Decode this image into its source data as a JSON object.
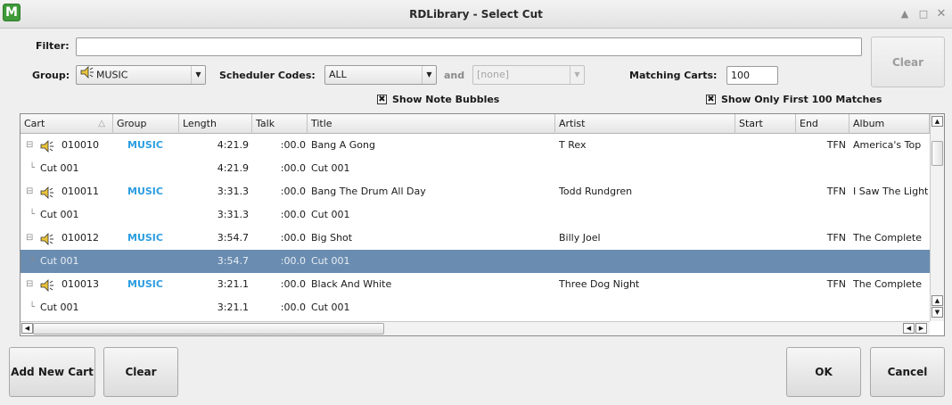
{
  "window": {
    "title": "RDLibrary - Select Cut",
    "app_icon_letter": "M",
    "controls": [
      "chevron-up",
      "maximize",
      "close"
    ]
  },
  "filter": {
    "label": "Filter:",
    "value": ""
  },
  "group": {
    "label": "Group:",
    "value": "MUSIC"
  },
  "scheduler": {
    "label": "Scheduler Codes:",
    "value": "ALL",
    "and_label": "and",
    "second_value": "[none]"
  },
  "matching": {
    "label": "Matching Carts:",
    "value": "100"
  },
  "top_clear_label": "Clear",
  "checks": {
    "note_bubbles": {
      "label": "Show Note Bubbles",
      "checked": true
    },
    "first_100": {
      "label": "Show Only First 100 Matches",
      "checked": true
    }
  },
  "columns": [
    "Cart",
    "Group",
    "Length",
    "Talk",
    "Title",
    "Artist",
    "Start",
    "End",
    "Album"
  ],
  "rows": [
    {
      "kind": "cart",
      "cart": "010010",
      "group": "MUSIC",
      "length": "4:21.9",
      "talk": ":00.0",
      "title": "Bang A Gong",
      "artist": "T Rex",
      "start": "",
      "end": "TFN",
      "album": "America's Top"
    },
    {
      "kind": "cut",
      "cart": "Cut 001",
      "group": "",
      "length": "4:21.9",
      "talk": ":00.0",
      "title": "Cut 001",
      "artist": "",
      "start": "",
      "end": "",
      "album": ""
    },
    {
      "kind": "cart",
      "cart": "010011",
      "group": "MUSIC",
      "length": "3:31.3",
      "talk": ":00.0",
      "title": "Bang The Drum All Day",
      "artist": "Todd Rundgren",
      "start": "",
      "end": "TFN",
      "album": "I Saw The Light"
    },
    {
      "kind": "cut",
      "cart": "Cut 001",
      "group": "",
      "length": "3:31.3",
      "talk": ":00.0",
      "title": "Cut 001",
      "artist": "",
      "start": "",
      "end": "",
      "album": ""
    },
    {
      "kind": "cart",
      "cart": "010012",
      "group": "MUSIC",
      "length": "3:54.7",
      "talk": ":00.0",
      "title": "Big Shot",
      "artist": "Billy Joel",
      "start": "",
      "end": "TFN",
      "album": "The Complete"
    },
    {
      "kind": "cut",
      "cart": "Cut 001",
      "group": "",
      "length": "3:54.7",
      "talk": ":00.0",
      "title": "Cut 001",
      "artist": "",
      "start": "",
      "end": "",
      "album": "",
      "selected": true
    },
    {
      "kind": "cart",
      "cart": "010013",
      "group": "MUSIC",
      "length": "3:21.1",
      "talk": ":00.0",
      "title": "Black And White",
      "artist": "Three Dog Night",
      "start": "",
      "end": "TFN",
      "album": "The Complete"
    },
    {
      "kind": "cut",
      "cart": "Cut 001",
      "group": "",
      "length": "3:21.1",
      "talk": ":00.0",
      "title": "Cut 001",
      "artist": "",
      "start": "",
      "end": "",
      "album": ""
    }
  ],
  "buttons": {
    "add_new_cart": "Add New Cart",
    "clear": "Clear",
    "ok": "OK",
    "cancel": "Cancel"
  },
  "colors": {
    "group_text": "#2c9ee0",
    "selection": "#6a8cb0",
    "app_icon": "#3f9a3a"
  }
}
